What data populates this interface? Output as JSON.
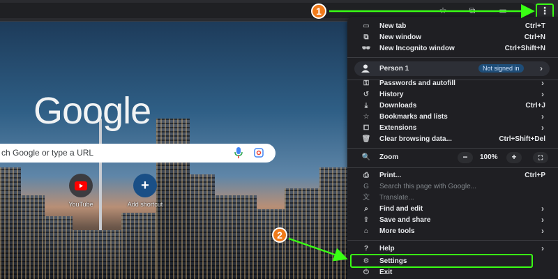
{
  "ntp": {
    "logo": "Google",
    "search_placeholder": "ch Google or type a URL",
    "shortcuts": [
      {
        "label": "YouTube",
        "icon": "youtube-icon"
      },
      {
        "label": "Add shortcut",
        "icon": "plus-icon"
      }
    ]
  },
  "menu": {
    "items": [
      {
        "label": "New tab",
        "shortcut": "Ctrl+T",
        "icon": "new-tab-icon"
      },
      {
        "label": "New window",
        "shortcut": "Ctrl+N",
        "icon": "new-window-icon"
      },
      {
        "label": "New Incognito window",
        "shortcut": "Ctrl+Shift+N",
        "icon": "incognito-icon"
      },
      {
        "label": "Passwords and autofill",
        "icon": "key-icon"
      },
      {
        "label": "History",
        "icon": "history-icon"
      },
      {
        "label": "Downloads",
        "shortcut": "Ctrl+J",
        "icon": "download-icon"
      },
      {
        "label": "Bookmarks and lists",
        "icon": "star-icon"
      },
      {
        "label": "Extensions",
        "icon": "puzzle-icon"
      },
      {
        "label": "Clear browsing data...",
        "shortcut": "Ctrl+Shift+Del",
        "icon": "trash-icon"
      },
      {
        "label": "Zoom",
        "icon": "zoom-icon"
      },
      {
        "label": "Print...",
        "shortcut": "Ctrl+P",
        "icon": "print-icon"
      },
      {
        "label": "Search this page with Google...",
        "icon": "google-g-icon"
      },
      {
        "label": "Translate...",
        "icon": "translate-icon"
      },
      {
        "label": "Find and edit",
        "icon": "find-icon"
      },
      {
        "label": "Save and share",
        "icon": "save-icon"
      },
      {
        "label": "More tools",
        "icon": "toolbox-icon"
      },
      {
        "label": "Help",
        "icon": "help-icon"
      },
      {
        "label": "Settings",
        "icon": "gear-icon"
      },
      {
        "label": "Exit",
        "icon": "exit-icon"
      }
    ],
    "profile": {
      "name": "Person 1",
      "status": "Not signed in"
    },
    "zoom": {
      "value": "100%",
      "minus": "−",
      "plus": "+"
    }
  },
  "annotations": {
    "step1": "1",
    "step2": "2"
  },
  "colors": {
    "annotation_green": "#39ff14",
    "callout_orange": "#f07a1a",
    "menu_bg": "#1f1f23",
    "badge_bg": "#1e4d78"
  }
}
